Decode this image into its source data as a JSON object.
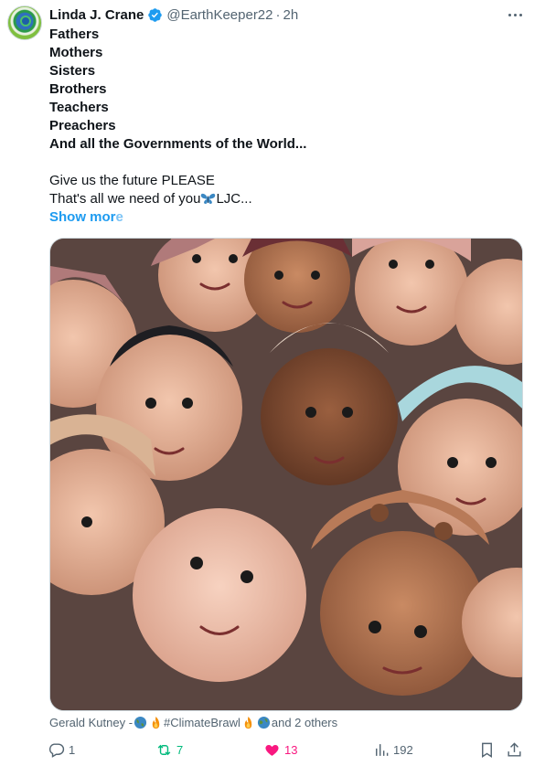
{
  "author": {
    "name": "Linda J. Crane",
    "handle": "@EarthKeeper22",
    "separator": "·",
    "time": "2h",
    "verified_color": "#1d9bf0"
  },
  "tweet": {
    "bold_lines": [
      "Fathers",
      "Mothers",
      "Sisters",
      "Brothers",
      "Teachers",
      "Preachers",
      "And all the Governments of the World..."
    ],
    "line1": "Give us the future PLEASE",
    "line2_before": "That's all we need of you",
    "line2_after": "LJC...",
    "show_more": "Show mor",
    "show_more_fade": "e"
  },
  "media": {
    "icon": "photo-of-babies"
  },
  "tagline": {
    "prefix": "Gerald Kutney - ",
    "tag": "#ClimateBrawl",
    "suffix": " and 2 others"
  },
  "actions": {
    "replies": "1",
    "reposts": "7",
    "likes": "13",
    "views": "192",
    "repost_color": "#00ba7c",
    "like_color": "#f91880"
  }
}
